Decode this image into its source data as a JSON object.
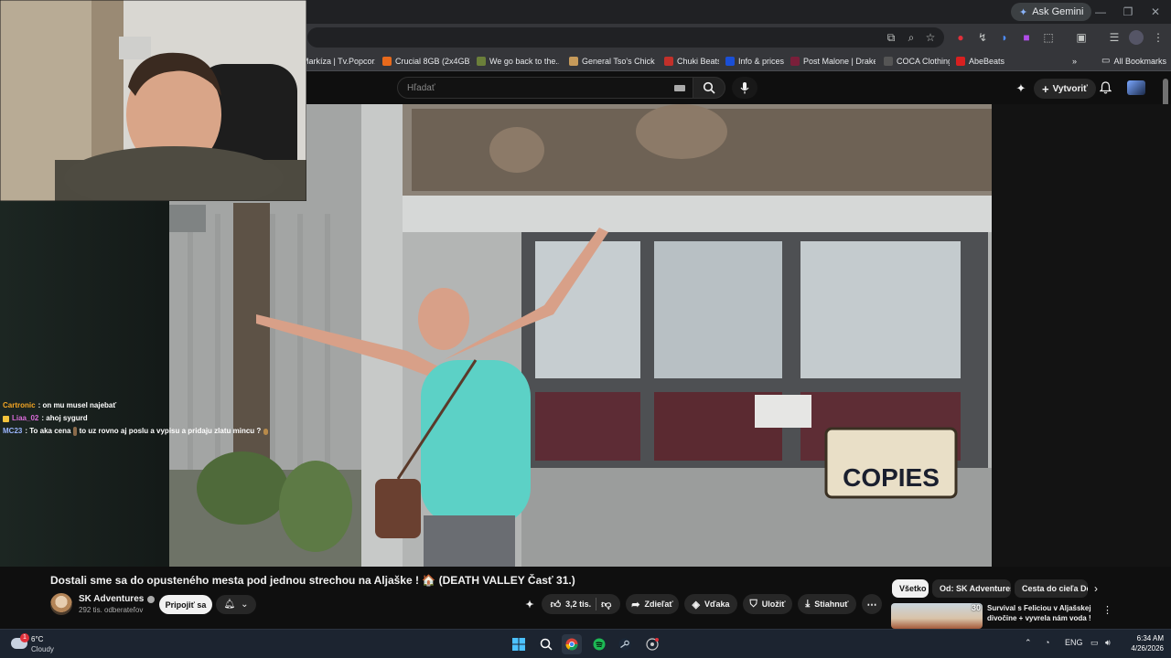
{
  "browser": {
    "ask_gemini": "Ask Gemini",
    "bookmarks": [
      {
        "label": "Markíza | Tv.Popcor...",
        "color": "#e05a2a"
      },
      {
        "label": "Crucial 8GB (2x4GB)...",
        "color": "#e86a1c"
      },
      {
        "label": "We go back to the...",
        "color": "#6b7f3a"
      },
      {
        "label": "General Tso's Chick...",
        "color": "#c69a5a"
      },
      {
        "label": "Chuki Beats",
        "color": "#c2302a"
      },
      {
        "label": "Info & prices",
        "color": "#1a4fd6"
      },
      {
        "label": "Post Malone | Drake...",
        "color": "#7a1f3a"
      },
      {
        "label": "COCA Clothing",
        "color": "#303030"
      },
      {
        "label": "AbeBeats",
        "color": "#d82020"
      }
    ],
    "all_bookmarks": "All Bookmarks"
  },
  "youtube": {
    "search_placeholder": "Hľadať",
    "create_label": "Vytvoriť"
  },
  "chat": [
    {
      "user": "Cartronic",
      "user_color": "#f5a623",
      "message": ": on mu musel najebať"
    },
    {
      "user": "Liaa_02",
      "user_color": "#d86bd8",
      "message": ": ahoj sygurd"
    },
    {
      "user": "MC23",
      "user_color": "#9bb6ff",
      "message": ": To aka cena",
      "message2": "to uz rovno aj poslu a vypisu a pridaju zlatu mincu ?"
    }
  ],
  "video": {
    "title": "Dostali sme sa do opusteného mesta pod jednou strechou na Aljaške ! 🏠 (DEATH VALLEY Časť 31.)",
    "channel_name": "SK Adventures",
    "subscribers": "292 tis. odberateľov",
    "join_label": "Pripojiť sa",
    "likes": "3,2 tis.",
    "share_label": "Zdieľať",
    "thanks_label": "Vďaka",
    "save_label": "Uložiť",
    "download_label": "Stiahnuť",
    "sign_text": "COPIES"
  },
  "related": {
    "chips": [
      "Všetko",
      "Od: SK Adventures",
      "Cesta do cieľa Do"
    ],
    "first_title": "Survival s Feliciou v Aljašskej divočine + vyvrela nám voda ! ...",
    "first_number": "30"
  },
  "taskbar": {
    "temperature": "6°C",
    "weather": "Cloudy",
    "weather_badge": "1",
    "language": "ENG",
    "time": "6:34 AM",
    "date": "4/26/2026"
  }
}
